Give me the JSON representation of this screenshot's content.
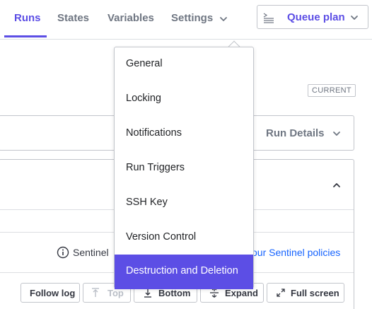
{
  "nav": {
    "tabs": [
      {
        "label": "Runs",
        "active": true
      },
      {
        "label": "States",
        "active": false
      },
      {
        "label": "Variables",
        "active": false
      },
      {
        "label": "Settings",
        "active": false
      }
    ],
    "queue_plan_label": "Queue plan"
  },
  "status_badge": "CURRENT",
  "run_details_label": "Run Details",
  "sentinel": {
    "text": "Sentinel",
    "link": "our Sentinel policies"
  },
  "log_buttons": {
    "follow_log": "Follow log",
    "top": "Top",
    "bottom": "Bottom",
    "expand": "Expand",
    "full_screen": "Full screen"
  },
  "settings_menu": {
    "items": [
      {
        "label": "General"
      },
      {
        "label": "Locking"
      },
      {
        "label": "Notifications"
      },
      {
        "label": "Run Triggers"
      },
      {
        "label": "SSH Key"
      },
      {
        "label": "Version Control"
      },
      {
        "label": "Destruction and Deletion",
        "active": true
      }
    ]
  },
  "colors": {
    "accent": "#5c4ee5",
    "link": "#1563ff",
    "muted": "#6f7682",
    "border": "#c2c5cb"
  },
  "icons": {
    "settings_chevron": "chevron-down-icon",
    "queue_plan": "queue-list-icon",
    "sentinel_info": "info-circle-icon"
  }
}
